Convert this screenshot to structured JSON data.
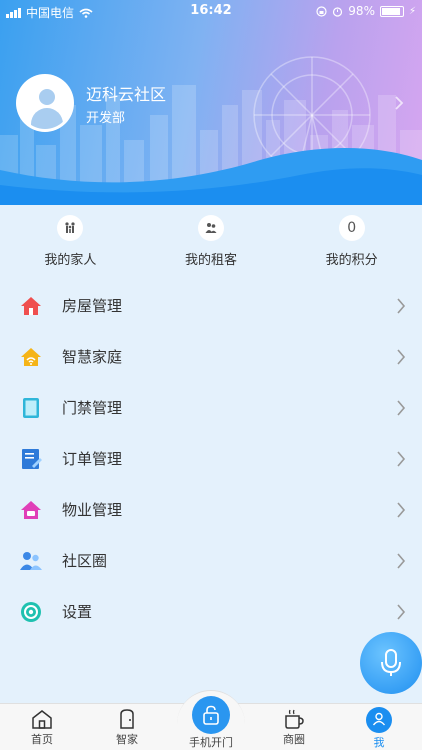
{
  "status_bar": {
    "carrier": "中国电信",
    "time": "16:42",
    "battery": "98%"
  },
  "profile": {
    "name": "迈科云社区",
    "department": "开发部"
  },
  "stats": [
    {
      "label": "我的家人",
      "icon": "family-icon"
    },
    {
      "label": "我的租客",
      "icon": "tenant-icon"
    },
    {
      "label": "我的积分",
      "value": "0"
    }
  ],
  "menu": [
    {
      "label": "房屋管理",
      "icon": "house-icon"
    },
    {
      "label": "智慧家庭",
      "icon": "smart-home-icon"
    },
    {
      "label": "门禁管理",
      "icon": "door-access-icon"
    },
    {
      "label": "订单管理",
      "icon": "order-icon"
    },
    {
      "label": "物业管理",
      "icon": "property-icon"
    },
    {
      "label": "社区圈",
      "icon": "community-icon"
    },
    {
      "label": "设置",
      "icon": "gear-icon"
    }
  ],
  "tabs": [
    {
      "label": "首页"
    },
    {
      "label": "智家"
    },
    {
      "label": "手机开门"
    },
    {
      "label": "商圈"
    },
    {
      "label": "我"
    }
  ],
  "colors": {
    "accent": "#1b8ef0",
    "background": "#e4f1fc"
  }
}
